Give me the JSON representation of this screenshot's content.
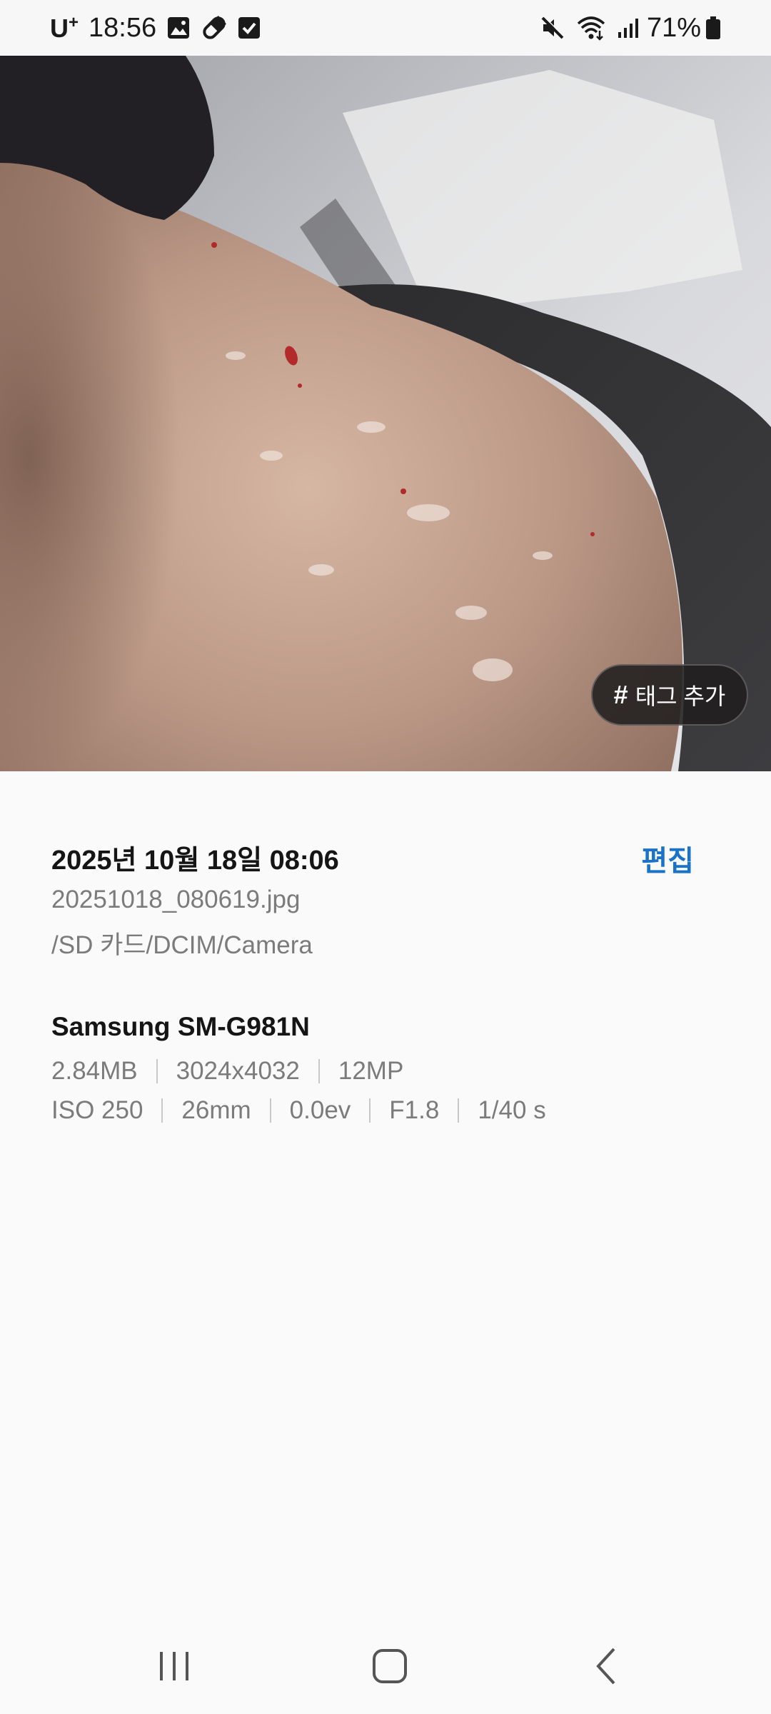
{
  "status_bar": {
    "carrier": "U",
    "carrier_sup": "+",
    "time": "18:56",
    "battery": "71%"
  },
  "photo": {
    "tag_button": {
      "hash": "#",
      "label": "태그 추가"
    }
  },
  "details": {
    "date": "2025년 10월 18일 08:06",
    "edit_label": "편집",
    "file_name": "20251018_080619.jpg",
    "file_path": "/SD 카드/DCIM/Camera",
    "device": "Samsung SM-G981N",
    "file_size": "2.84MB",
    "resolution": "3024x4032",
    "megapixels": "12MP",
    "iso": "ISO 250",
    "focal_length": "26mm",
    "exposure": "0.0ev",
    "aperture": "F1.8",
    "shutter": "1/40 s"
  },
  "nav_bar": {
    "icons": [
      "recents-icon",
      "home-icon",
      "back-icon"
    ]
  },
  "colors": {
    "accent": "#1a73c8",
    "secondary_text": "#7b7b7b",
    "background": "#fafafa"
  }
}
